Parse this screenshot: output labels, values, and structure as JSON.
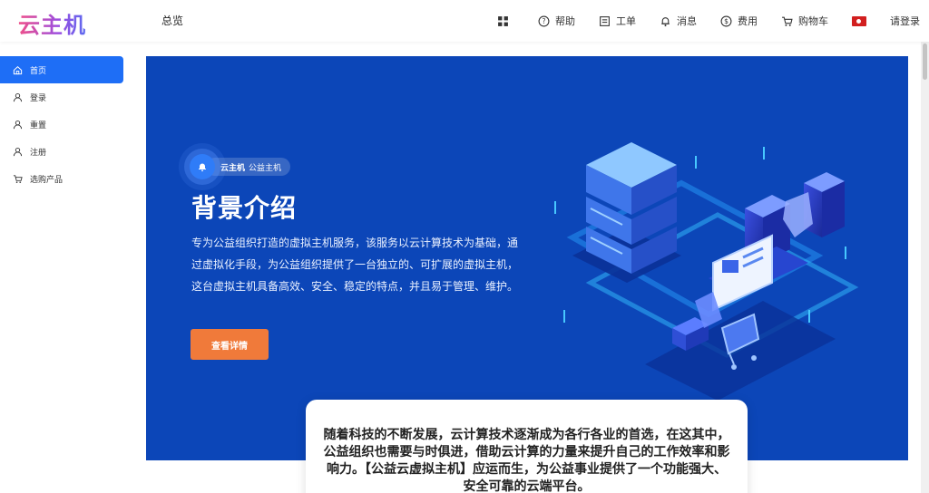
{
  "app": {
    "logo": "云主机"
  },
  "header": {
    "nav_title": "总览",
    "items": [
      {
        "icon": "grid-icon",
        "label": ""
      },
      {
        "icon": "help-icon",
        "label": "帮助"
      },
      {
        "icon": "ticket-icon",
        "label": "工单"
      },
      {
        "icon": "bell-icon",
        "label": "消息"
      },
      {
        "icon": "dollar-icon",
        "label": "费用"
      },
      {
        "icon": "cart-icon",
        "label": "购物车"
      },
      {
        "icon": "flag-hk-icon",
        "label": ""
      },
      {
        "icon": "",
        "label": "请登录"
      }
    ]
  },
  "sidebar": {
    "items": [
      {
        "label": "首页",
        "icon": "home-icon",
        "active": true
      },
      {
        "label": "登录",
        "icon": "user-icon"
      },
      {
        "label": "重置",
        "icon": "user-icon"
      },
      {
        "label": "注册",
        "icon": "user-icon"
      },
      {
        "label": "选购产品",
        "icon": "cart-icon"
      }
    ]
  },
  "hero": {
    "badge_strong": "云主机",
    "badge_text": "公益主机",
    "title": "背景介绍",
    "description": "专为公益组织打造的虚拟主机服务，该服务以云计算技术为基础，通过虚拟化手段，为公益组织提供了一台独立的、可扩展的虚拟主机，这台虚拟主机具备高效、安全、稳定的特点，并且易于管理、维护。",
    "button_label": "查看详情"
  },
  "card": {
    "text": "随着科技的不断发展，云计算技术逐渐成为各行各业的首选，在这其中，公益组织也需要与时俱进，借助云计算的力量来提升自己的工作效率和影响力。【公益云虚拟主机】应运而生，为公益事业提供了一个功能强大、安全可靠的云端平台。"
  },
  "colors": {
    "primary": "#1e6ef6",
    "hero_bg": "#0c46b8",
    "button": "#f07a3a"
  }
}
